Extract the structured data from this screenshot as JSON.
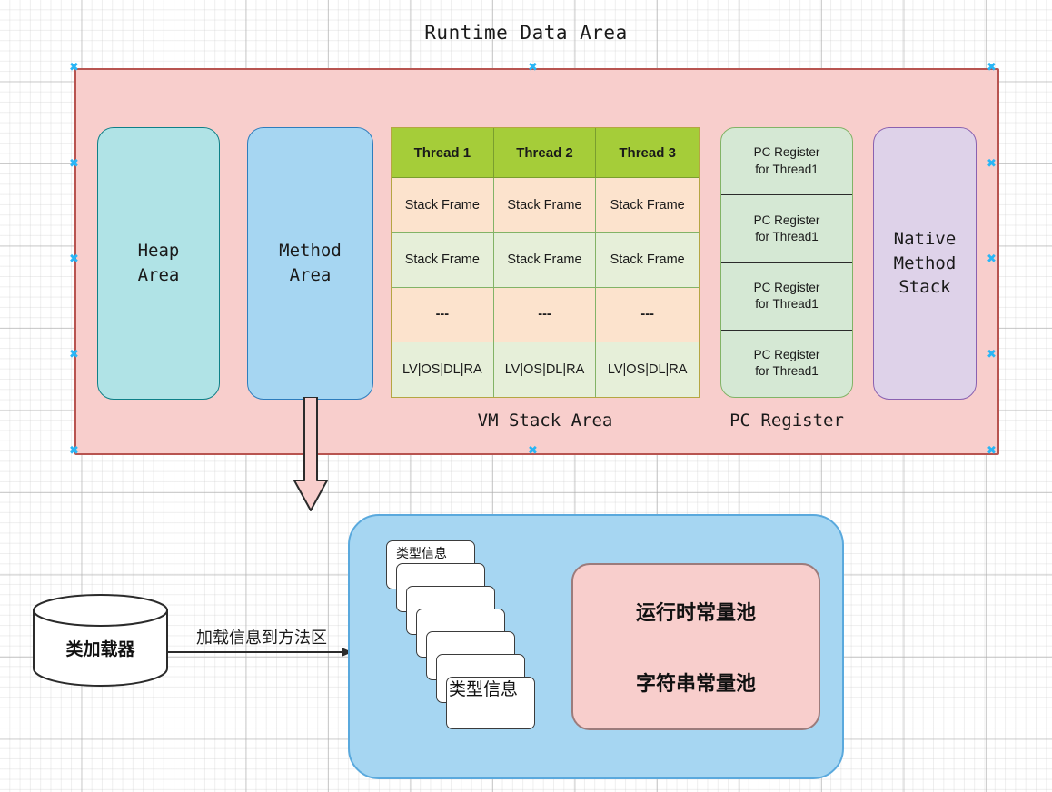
{
  "title": "Runtime Data Area",
  "runtime_area": {
    "border_color": "#b85450",
    "fill_color": "#f8cecc",
    "heap": {
      "label_line1": "Heap",
      "label_line2": "Area",
      "fill": "#b0e3e6"
    },
    "method_area": {
      "label_line1": "Method",
      "label_line2": "Area",
      "fill": "#a6d6f2"
    },
    "native_method_stack": {
      "label_line1": "Native",
      "label_line2": "Method",
      "label_line3": "Stack",
      "fill": "#ded2e9"
    },
    "vm_stack": {
      "caption": "VM Stack Area",
      "headers": [
        "Thread 1",
        "Thread 2",
        "Thread 3"
      ],
      "rows": [
        [
          "Stack Frame",
          "Stack Frame",
          "Stack Frame"
        ],
        [
          "Stack Frame",
          "Stack Frame",
          "Stack Frame"
        ],
        [
          "---",
          "---",
          "---"
        ],
        [
          "LV|OS|DL|RA",
          "LV|OS|DL|RA",
          "LV|OS|DL|RA"
        ]
      ],
      "header_fill": "#a5cd39",
      "row_fill_odd": "#fce3cd",
      "row_fill_even": "#e6efd9"
    },
    "pc_register": {
      "caption": "PC Register",
      "fill": "#d5e8d4",
      "rows": [
        {
          "line1": "PC Register",
          "line2": "for  Thread1"
        },
        {
          "line1": "PC Register",
          "line2": "for  Thread1"
        },
        {
          "line1": "PC Register",
          "line2": "for  Thread1"
        },
        {
          "line1": "PC Register",
          "line2": "for  Thread1"
        }
      ]
    }
  },
  "class_loader": {
    "label": "类加载器",
    "arrow_label": "加载信息到方法区"
  },
  "method_area_detail": {
    "fill": "#a6d6f2",
    "type_info_top": "类型信息",
    "type_info_bottom": "类型信息",
    "constant_pool": {
      "fill": "#f8cecc",
      "line1": "运行时常量池",
      "line2": "字符串常量池"
    }
  }
}
